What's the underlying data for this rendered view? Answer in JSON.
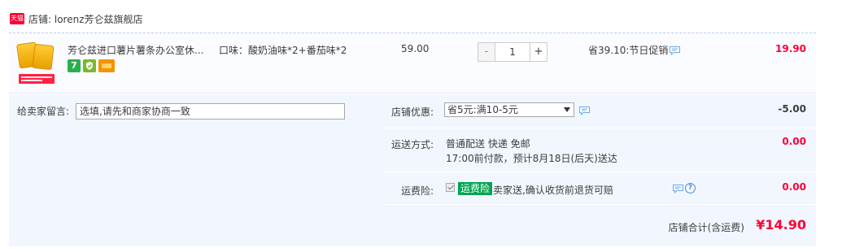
{
  "shop": {
    "badge": "天猫",
    "label": "店铺: lorenz芳仑兹旗舰店"
  },
  "item": {
    "title": "芳仑兹进口薯片薯条办公室休...",
    "sku": "口味：酸奶油味*2+番茄味*2",
    "unit_price": "59.00",
    "quantity": "1",
    "minus": "-",
    "plus": "+",
    "promo": "省39.10:节日促销",
    "subtotal": "19.90",
    "service_icons": [
      "seven-day-return-icon",
      "guarantee-icon",
      "credit-card-icon"
    ],
    "badge_7": "7"
  },
  "note": {
    "label": "给卖家留言:",
    "placeholder": "选填,请先和商家协商一致"
  },
  "coupon": {
    "label": "店铺优惠:",
    "selected": "省5元:满10-5元",
    "amount": "-5.00"
  },
  "shipping": {
    "label": "运送方式:",
    "method": "普通配送 快递 免邮",
    "eta": "17:00前付款，预计8月18日(后天)送达",
    "amount": "0.00"
  },
  "insurance": {
    "label": "运费险:",
    "badge": "运费险",
    "desc": "卖家送,确认收货前退货可赔",
    "amount": "0.00",
    "help": "?"
  },
  "total": {
    "label": "店铺合计(含运费)",
    "value": "¥14.90"
  },
  "colors": {
    "price_red": "#ff0036",
    "accent_green": "#00a54f",
    "panel_blue": "#f2f7ff"
  }
}
